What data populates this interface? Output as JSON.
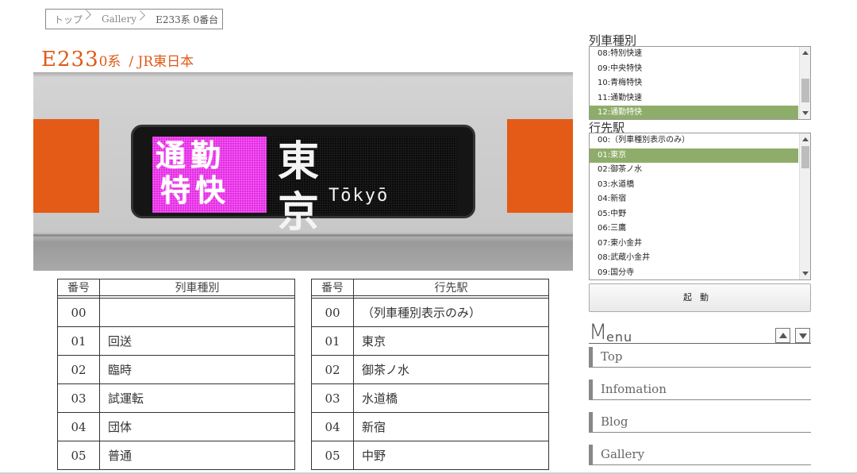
{
  "breadcrumb": {
    "items": [
      "トップ",
      "Gallery",
      "E233系 0番台"
    ]
  },
  "heading": {
    "model": "E233",
    "variant": "0系",
    "company": "/ JR東日本"
  },
  "display": {
    "type_line1": "通勤",
    "type_line2": "特快",
    "type_color": "#d81fd8",
    "dest_kanji": "東京",
    "dest_romaji": "Tōkyō"
  },
  "type_table": {
    "headers": [
      "番号",
      "列車種別"
    ],
    "rows": [
      [
        "00",
        ""
      ],
      [
        "01",
        "回送"
      ],
      [
        "02",
        "臨時"
      ],
      [
        "03",
        "試運転"
      ],
      [
        "04",
        "団体"
      ],
      [
        "05",
        "普通"
      ]
    ]
  },
  "dest_table": {
    "headers": [
      "番号",
      "行先駅"
    ],
    "rows": [
      [
        "00",
        "（列車種別表示のみ）"
      ],
      [
        "01",
        "東京"
      ],
      [
        "02",
        "御茶ノ水"
      ],
      [
        "03",
        "水道橋"
      ],
      [
        "04",
        "新宿"
      ],
      [
        "05",
        "中野"
      ]
    ]
  },
  "train_type_select": {
    "label": "列車種別",
    "options": [
      "08:特別快速",
      "09:中央特快",
      "10:青梅特快",
      "11:通勤快速",
      "12:通勤特快"
    ],
    "selected": "12:通勤特快"
  },
  "destination_select": {
    "label": "行先駅",
    "options": [
      "00:（列車種別表示のみ）",
      "01:東京",
      "02:御茶ノ水",
      "03:水道橋",
      "04:新宿",
      "05:中野",
      "06:三鷹",
      "07:東小金井",
      "08:武蔵小金井",
      "09:国分寺"
    ],
    "selected": "01:東京"
  },
  "start_button": {
    "label": "起動"
  },
  "menu": {
    "title_m": "M",
    "title_rest": "enu",
    "items": [
      "Top",
      "Infomation",
      "Blog",
      "Gallery"
    ]
  },
  "colors": {
    "accent": "#e05a18",
    "body_orange": "#e35b17",
    "selected_option": "#8fad6a"
  }
}
